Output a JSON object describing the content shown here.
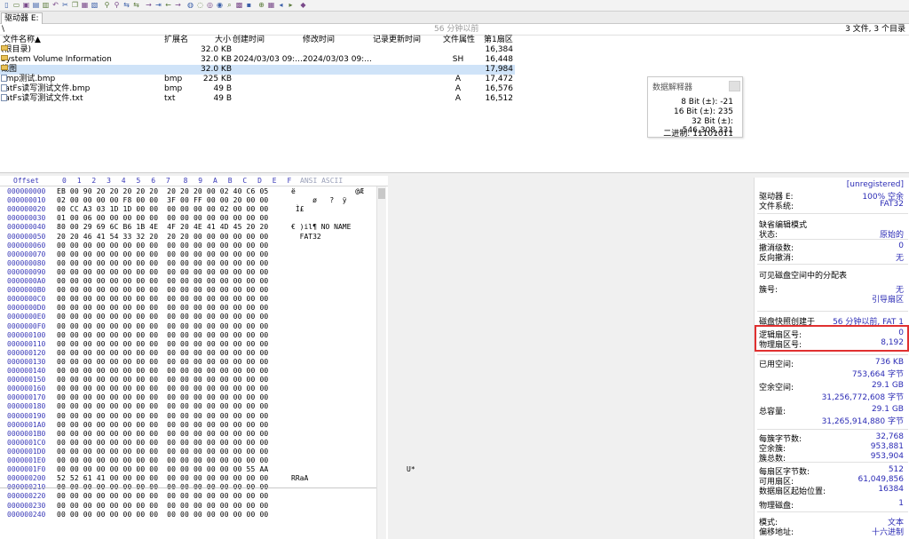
{
  "toolbar_icons": [
    "new-file-icon",
    "open-icon",
    "save-icon",
    "save-all-icon",
    "print-icon",
    "undo-icon",
    "cut-icon",
    "copy-icon",
    "paste-icon",
    "paste-write-icon",
    "find-icon",
    "find-hex-icon",
    "replace-icon",
    "replace-hex-icon",
    "goto-offset-icon",
    "goto-sector-icon",
    "back-icon",
    "forward-icon",
    "open-disk-icon",
    "disk-tool-icon",
    "scan-icon",
    "recover-icon",
    "search-icon",
    "hex-icon",
    "calc-icon",
    "zoom-icon",
    "table-icon",
    "stop-icon",
    "play-icon",
    "tag-icon"
  ],
  "tab": {
    "label": "驱动器 E:"
  },
  "pathbar": {
    "path": "\\",
    "ghost": "56 分钟以前",
    "summary": "3 文件, 3 个目录"
  },
  "filelist": {
    "headers": {
      "name": "文件名称▲",
      "ext": "扩展名",
      "size": "大小",
      "created": "创建时间",
      "modified": "修改时间",
      "accessed": "记录更新时间",
      "attr": "文件属性",
      "first_sector": "第1扇区"
    },
    "rows": [
      {
        "name": "(根目录)",
        "ext": "",
        "size": "32.0 KB",
        "created": "",
        "modified": "",
        "attr": "",
        "sector": "16,384",
        "type": "folder"
      },
      {
        "name": "System Volume Information",
        "ext": "",
        "size": "32.0 KB",
        "created": "2024/03/03   09:...",
        "modified": "2024/03/03   09:...",
        "attr": "SH",
        "sector": "16,448",
        "type": "folder"
      },
      {
        "name": "截图",
        "ext": "",
        "size": "32.0 KB",
        "created": "",
        "modified": "",
        "attr": "",
        "sector": "17,984",
        "type": "folder"
      },
      {
        "name": "bmp测试.bmp",
        "ext": "bmp",
        "size": "225 KB",
        "created": "",
        "modified": "",
        "attr": "A",
        "sector": "17,472",
        "type": "file"
      },
      {
        "name": "FatFs读写测试文件.bmp",
        "ext": "bmp",
        "size": "49 B",
        "created": "",
        "modified": "",
        "attr": "A",
        "sector": "16,576",
        "type": "file"
      },
      {
        "name": "FatFs读写测试文件.txt",
        "ext": "txt",
        "size": "49 B",
        "created": "",
        "modified": "",
        "attr": "A",
        "sector": "16,512",
        "type": "file"
      }
    ]
  },
  "interpreter": {
    "title": "数据解释器",
    "lines": [
      "8 Bit (±): -21",
      "16 Bit (±): 235",
      "32 Bit (±): 546,308,331",
      "二进制: 11101011"
    ]
  },
  "hex": {
    "header_offset": "Offset",
    "header_cols": [
      "0",
      "1",
      "2",
      "3",
      "4",
      "5",
      "6",
      "7",
      "8",
      "9",
      "A",
      "B",
      "C",
      "D",
      "E",
      "F"
    ],
    "header_ascii": "ANSI ASCII",
    "rows": [
      {
        "off": "000000000",
        "hex": "EB 00 90 20 20 20 20 20  20 20 20 00 02 40 C6 05",
        "asc": "ë              @Æ"
      },
      {
        "off": "000000010",
        "hex": "02 00 00 00 00 F8 00 00  3F 00 FF 00 00 20 00 00",
        "asc": "     ø   ?  ÿ"
      },
      {
        "off": "000000020",
        "hex": "00 CC A3 03 1D 1D 00 00  00 00 00 00 02 00 00 00",
        "asc": " Ì£"
      },
      {
        "off": "000000030",
        "hex": "01 00 06 00 00 00 00 00  00 00 00 00 00 00 00 00",
        "asc": ""
      },
      {
        "off": "000000040",
        "hex": "80 00 29 69 6C B6 1B 4E  4F 20 4E 41 4D 45 20 20",
        "asc": "€ )il¶ NO NAME"
      },
      {
        "off": "000000050",
        "hex": "20 20 46 41 54 33 32 20  20 20 00 00 00 00 00 00",
        "asc": "  FAT32"
      },
      {
        "off": "000000060",
        "hex": "00 00 00 00 00 00 00 00  00 00 00 00 00 00 00 00",
        "asc": ""
      },
      {
        "off": "000000070",
        "hex": "00 00 00 00 00 00 00 00  00 00 00 00 00 00 00 00",
        "asc": ""
      },
      {
        "off": "000000080",
        "hex": "00 00 00 00 00 00 00 00  00 00 00 00 00 00 00 00",
        "asc": ""
      },
      {
        "off": "000000090",
        "hex": "00 00 00 00 00 00 00 00  00 00 00 00 00 00 00 00",
        "asc": ""
      },
      {
        "off": "0000000A0",
        "hex": "00 00 00 00 00 00 00 00  00 00 00 00 00 00 00 00",
        "asc": ""
      },
      {
        "off": "0000000B0",
        "hex": "00 00 00 00 00 00 00 00  00 00 00 00 00 00 00 00",
        "asc": ""
      },
      {
        "off": "0000000C0",
        "hex": "00 00 00 00 00 00 00 00  00 00 00 00 00 00 00 00",
        "asc": ""
      },
      {
        "off": "0000000D0",
        "hex": "00 00 00 00 00 00 00 00  00 00 00 00 00 00 00 00",
        "asc": ""
      },
      {
        "off": "0000000E0",
        "hex": "00 00 00 00 00 00 00 00  00 00 00 00 00 00 00 00",
        "asc": ""
      },
      {
        "off": "0000000F0",
        "hex": "00 00 00 00 00 00 00 00  00 00 00 00 00 00 00 00",
        "asc": ""
      },
      {
        "off": "000000100",
        "hex": "00 00 00 00 00 00 00 00  00 00 00 00 00 00 00 00",
        "asc": ""
      },
      {
        "off": "000000110",
        "hex": "00 00 00 00 00 00 00 00  00 00 00 00 00 00 00 00",
        "asc": ""
      },
      {
        "off": "000000120",
        "hex": "00 00 00 00 00 00 00 00  00 00 00 00 00 00 00 00",
        "asc": ""
      },
      {
        "off": "000000130",
        "hex": "00 00 00 00 00 00 00 00  00 00 00 00 00 00 00 00",
        "asc": ""
      },
      {
        "off": "000000140",
        "hex": "00 00 00 00 00 00 00 00  00 00 00 00 00 00 00 00",
        "asc": ""
      },
      {
        "off": "000000150",
        "hex": "00 00 00 00 00 00 00 00  00 00 00 00 00 00 00 00",
        "asc": ""
      },
      {
        "off": "000000160",
        "hex": "00 00 00 00 00 00 00 00  00 00 00 00 00 00 00 00",
        "asc": ""
      },
      {
        "off": "000000170",
        "hex": "00 00 00 00 00 00 00 00  00 00 00 00 00 00 00 00",
        "asc": ""
      },
      {
        "off": "000000180",
        "hex": "00 00 00 00 00 00 00 00  00 00 00 00 00 00 00 00",
        "asc": ""
      },
      {
        "off": "000000190",
        "hex": "00 00 00 00 00 00 00 00  00 00 00 00 00 00 00 00",
        "asc": ""
      },
      {
        "off": "0000001A0",
        "hex": "00 00 00 00 00 00 00 00  00 00 00 00 00 00 00 00",
        "asc": ""
      },
      {
        "off": "0000001B0",
        "hex": "00 00 00 00 00 00 00 00  00 00 00 00 00 00 00 00",
        "asc": ""
      },
      {
        "off": "0000001C0",
        "hex": "00 00 00 00 00 00 00 00  00 00 00 00 00 00 00 00",
        "asc": ""
      },
      {
        "off": "0000001D0",
        "hex": "00 00 00 00 00 00 00 00  00 00 00 00 00 00 00 00",
        "asc": ""
      },
      {
        "off": "0000001E0",
        "hex": "00 00 00 00 00 00 00 00  00 00 00 00 00 00 00 00",
        "asc": ""
      },
      {
        "off": "0000001F0",
        "hex": "00 00 00 00 00 00 00 00  00 00 00 00 00 00 55 AA",
        "asc": "                           U*"
      },
      {
        "off": "000000200",
        "hex": "52 52 61 41 00 00 00 00  00 00 00 00 00 00 00 00",
        "asc": "RRaA"
      },
      {
        "off": "000000210",
        "hex": "00 00 00 00 00 00 00 00  00 00 00 00 00 00 00 00",
        "asc": ""
      },
      {
        "off": "000000220",
        "hex": "00 00 00 00 00 00 00 00  00 00 00 00 00 00 00 00",
        "asc": ""
      },
      {
        "off": "000000230",
        "hex": "00 00 00 00 00 00 00 00  00 00 00 00 00 00 00 00",
        "asc": ""
      },
      {
        "off": "000000240",
        "hex": "00 00 00 00 00 00 00 00  00 00 00 00 00 00 00 00",
        "asc": ""
      }
    ]
  },
  "info": {
    "registration": "[unregistered]",
    "drive_label": "驱动器 E:",
    "drive_value": "100% 空余",
    "fs_label": "文件系统:",
    "fs_value": "FAT32",
    "edit_mode_label": "缺省编辑模式",
    "state_label": "状态:",
    "state_value": "原始的",
    "undo_label": "撤消级数:",
    "undo_value": "0",
    "redo_label": "反向撤消:",
    "redo_value": "无",
    "alloc_label": "可见磁盘空间中的分配表",
    "cluster_label": "簇号:",
    "cluster_value": "无",
    "cluster_value2": "引导扇区",
    "snapshot_label": "磁盘快照创建于",
    "snapshot_value": "56 分钟以前, FAT 1",
    "logical_label": "逻辑扇区号:",
    "logical_value": "0",
    "physical_label": "物理扇区号:",
    "physical_value": "8,192",
    "used_label": "已用空间:",
    "used_value": "736 KB",
    "used_value2": "753,664 字节",
    "free_label": "空余空间:",
    "free_value": "29.1 GB",
    "free_value2": "31,256,772,608 字节",
    "total_label": "总容量:",
    "total_value": "29.1 GB",
    "total_value2": "31,265,914,880 字节",
    "bpc_label": "每簇字节数:",
    "bpc_value": "32,768",
    "freecl_label": "空余簇:",
    "freecl_value": "953,881",
    "totalcl_label": "簇总数:",
    "totalcl_value": "953,904",
    "bps_label": "每扇区字节数:",
    "bps_value": "512",
    "avail_label": "可用扇区:",
    "avail_value": "61,049,856",
    "start_label": "数据扇区起始位置:",
    "start_value": "16384",
    "phys_disk_label": "物理磁盘:",
    "phys_disk_value": "1",
    "mode_label": "模式:",
    "mode_value": "文本",
    "offset_label": "偏移地址:",
    "offset_value": "十六进制"
  }
}
